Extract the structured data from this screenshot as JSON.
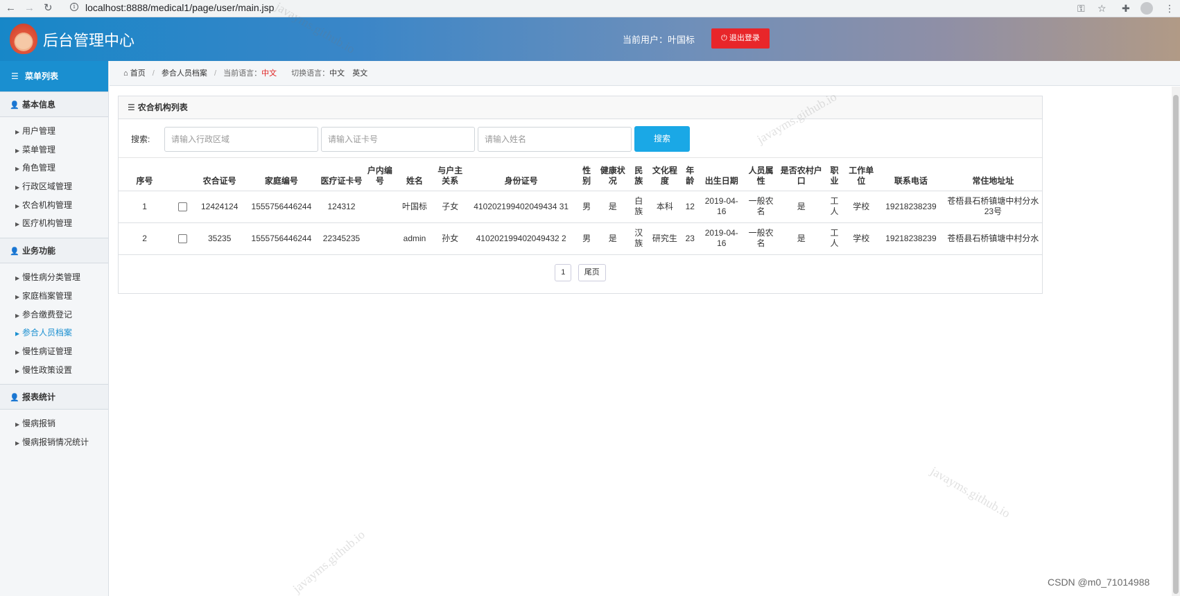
{
  "browser": {
    "url": "localhost:8888/medical1/page/user/main.jsp"
  },
  "header": {
    "title": "后台管理中心",
    "current_user_label": "当前用户：叶国标",
    "logout_label": "退出登录"
  },
  "sidebar": {
    "menu_title": "菜单列表",
    "groups": [
      {
        "label": "基本信息",
        "items": [
          "用户管理",
          "菜单管理",
          "角色管理",
          "行政区域管理",
          "农合机构管理",
          "医疗机构管理"
        ]
      },
      {
        "label": "业务功能",
        "items": [
          "慢性病分类管理",
          "家庭档案管理",
          "参合缴费登记",
          "参合人员档案",
          "慢性病证管理",
          "慢性政策设置"
        ]
      },
      {
        "label": "报表统计",
        "items": [
          "慢病报销",
          "慢病报销情况统计"
        ]
      }
    ],
    "active_item": "参合人员档案"
  },
  "breadcrumb": {
    "home": "首页",
    "current": "参合人员档案",
    "lang_label": "当前语言：",
    "lang_value": "中文",
    "switch_label": "切换语言：",
    "switch_cn": "中文",
    "switch_en": "英文"
  },
  "panel": {
    "title": "农合机构列表"
  },
  "search": {
    "label": "搜索:",
    "region_placeholder": "请输入行政区域",
    "card_placeholder": "请输入证卡号",
    "name_placeholder": "请输入姓名",
    "button_label": "搜索"
  },
  "table": {
    "headers": [
      "序号",
      "",
      "农合证号",
      "家庭编号",
      "医疗证卡号",
      "户内编号",
      "姓名",
      "与户主关系",
      "身份证号",
      "性别",
      "健康状况",
      "民族",
      "文化程度",
      "年龄",
      "出生日期",
      "人员属性",
      "是否农村户口",
      "职业",
      "工作单位",
      "联系电话",
      "常住地址址"
    ],
    "rows": [
      [
        "1",
        "",
        "12424124",
        "1555756446244",
        "124312",
        "",
        "叶国标",
        "子女",
        "410202199402049434 31",
        "男",
        "是",
        "白族",
        "本科",
        "12",
        "2019-04-16",
        "一般农名",
        "是",
        "工人",
        "学校",
        "19218238239",
        "苍梧县石桥镇塘中村分水23号"
      ],
      [
        "2",
        "",
        "35235",
        "1555756446244",
        "22345235",
        "",
        "admin",
        "孙女",
        "410202199402049432 2",
        "男",
        "是",
        "汉族",
        "研究生",
        "23",
        "2019-04-16",
        "一般农名",
        "是",
        "工人",
        "学校",
        "19218238239",
        "苍梧县石桥镇塘中村分水"
      ]
    ]
  },
  "pager": {
    "page": "1",
    "last_label": "尾页"
  },
  "watermark_text": "javayms.github.io",
  "footer_mark": "CSDN @m0_71014988"
}
